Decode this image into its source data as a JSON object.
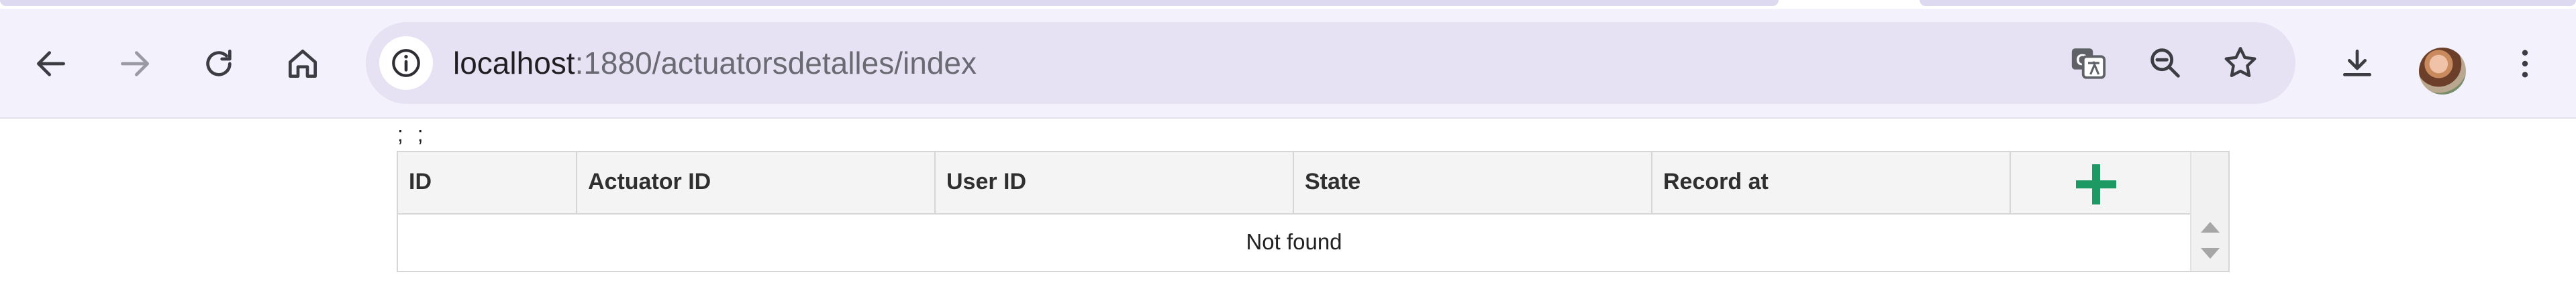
{
  "browser": {
    "url_host": "localhost",
    "url_path": ":1880/actuatorsdetalles/index",
    "icons": [
      "back-icon",
      "forward-icon",
      "reload-icon",
      "home-icon",
      "site-info-icon",
      "translate-icon",
      "zoom-out-icon",
      "bookmark-star-icon",
      "download-icon",
      "profile-avatar",
      "more-menu-icon"
    ]
  },
  "page": {
    "top_text": "; ;",
    "table": {
      "columns": [
        "ID",
        "Actuator ID",
        "User ID",
        "State",
        "Record at"
      ],
      "empty_message": "Not found"
    },
    "accent_color": "#1d9a63"
  }
}
